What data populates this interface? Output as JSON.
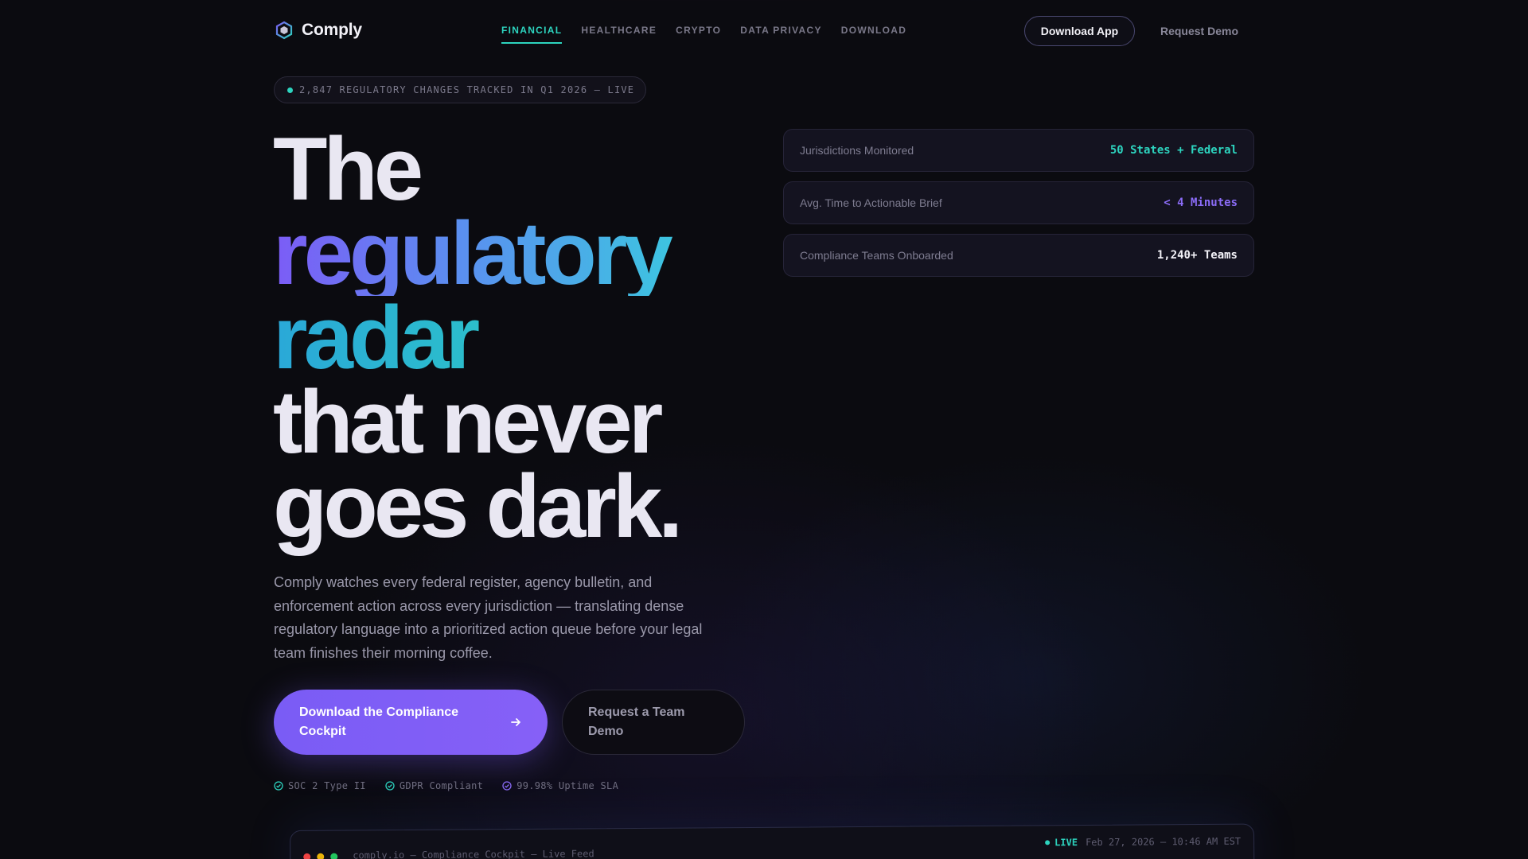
{
  "brand": {
    "name": "Comply",
    "icon": "hex-logo-icon"
  },
  "nav": {
    "links": [
      {
        "label": "FINANCIAL",
        "active": true
      },
      {
        "label": "HEALTHCARE",
        "active": false
      },
      {
        "label": "CRYPTO",
        "active": false
      },
      {
        "label": "DATA PRIVACY",
        "active": false
      },
      {
        "label": "DOWNLOAD",
        "active": false
      }
    ],
    "download_app": "Download App",
    "request_demo": "Request Demo"
  },
  "badge": {
    "text": "2,847 REGULATORY CHANGES TRACKED IN Q1 2026 — LIVE"
  },
  "hero": {
    "line1": "The",
    "line2": "regulatory",
    "line3": "radar",
    "line4": "that never",
    "line5": "goes dark.",
    "description": "Comply watches every federal register, agency bulletin, and enforcement action across every jurisdiction — translating dense regulatory language into a prioritized action queue before your legal team finishes their morning coffee.",
    "cta_primary": "Download the Compliance Cockpit",
    "cta_secondary": "Request a Team Demo"
  },
  "trust": [
    {
      "label": "SOC 2 Type II",
      "icon": "check-circle-icon"
    },
    {
      "label": "GDPR Compliant",
      "icon": "check-circle-icon"
    },
    {
      "label": "99.98% Uptime SLA",
      "icon": "check-circle-icon"
    }
  ],
  "stats": [
    {
      "label": "Jurisdictions Monitored",
      "value": "50 States + Federal",
      "color": "#2dd4bf"
    },
    {
      "label": "Avg. Time to Actionable Brief",
      "value": "< 4 Minutes",
      "color": "#8b6cf7"
    },
    {
      "label": "Compliance Teams Onboarded",
      "value": "1,240+ Teams",
      "color": "#f3f2f8"
    }
  ],
  "console": {
    "title": "comply.io — Compliance Cockpit — Live Feed",
    "live": "LIVE",
    "timestamp": "Feb 27, 2026 — 10:46 AM EST"
  },
  "colors": {
    "accent_teal": "#2dd4bf",
    "accent_violet": "#7a5cf5",
    "background": "#0b0b10"
  }
}
